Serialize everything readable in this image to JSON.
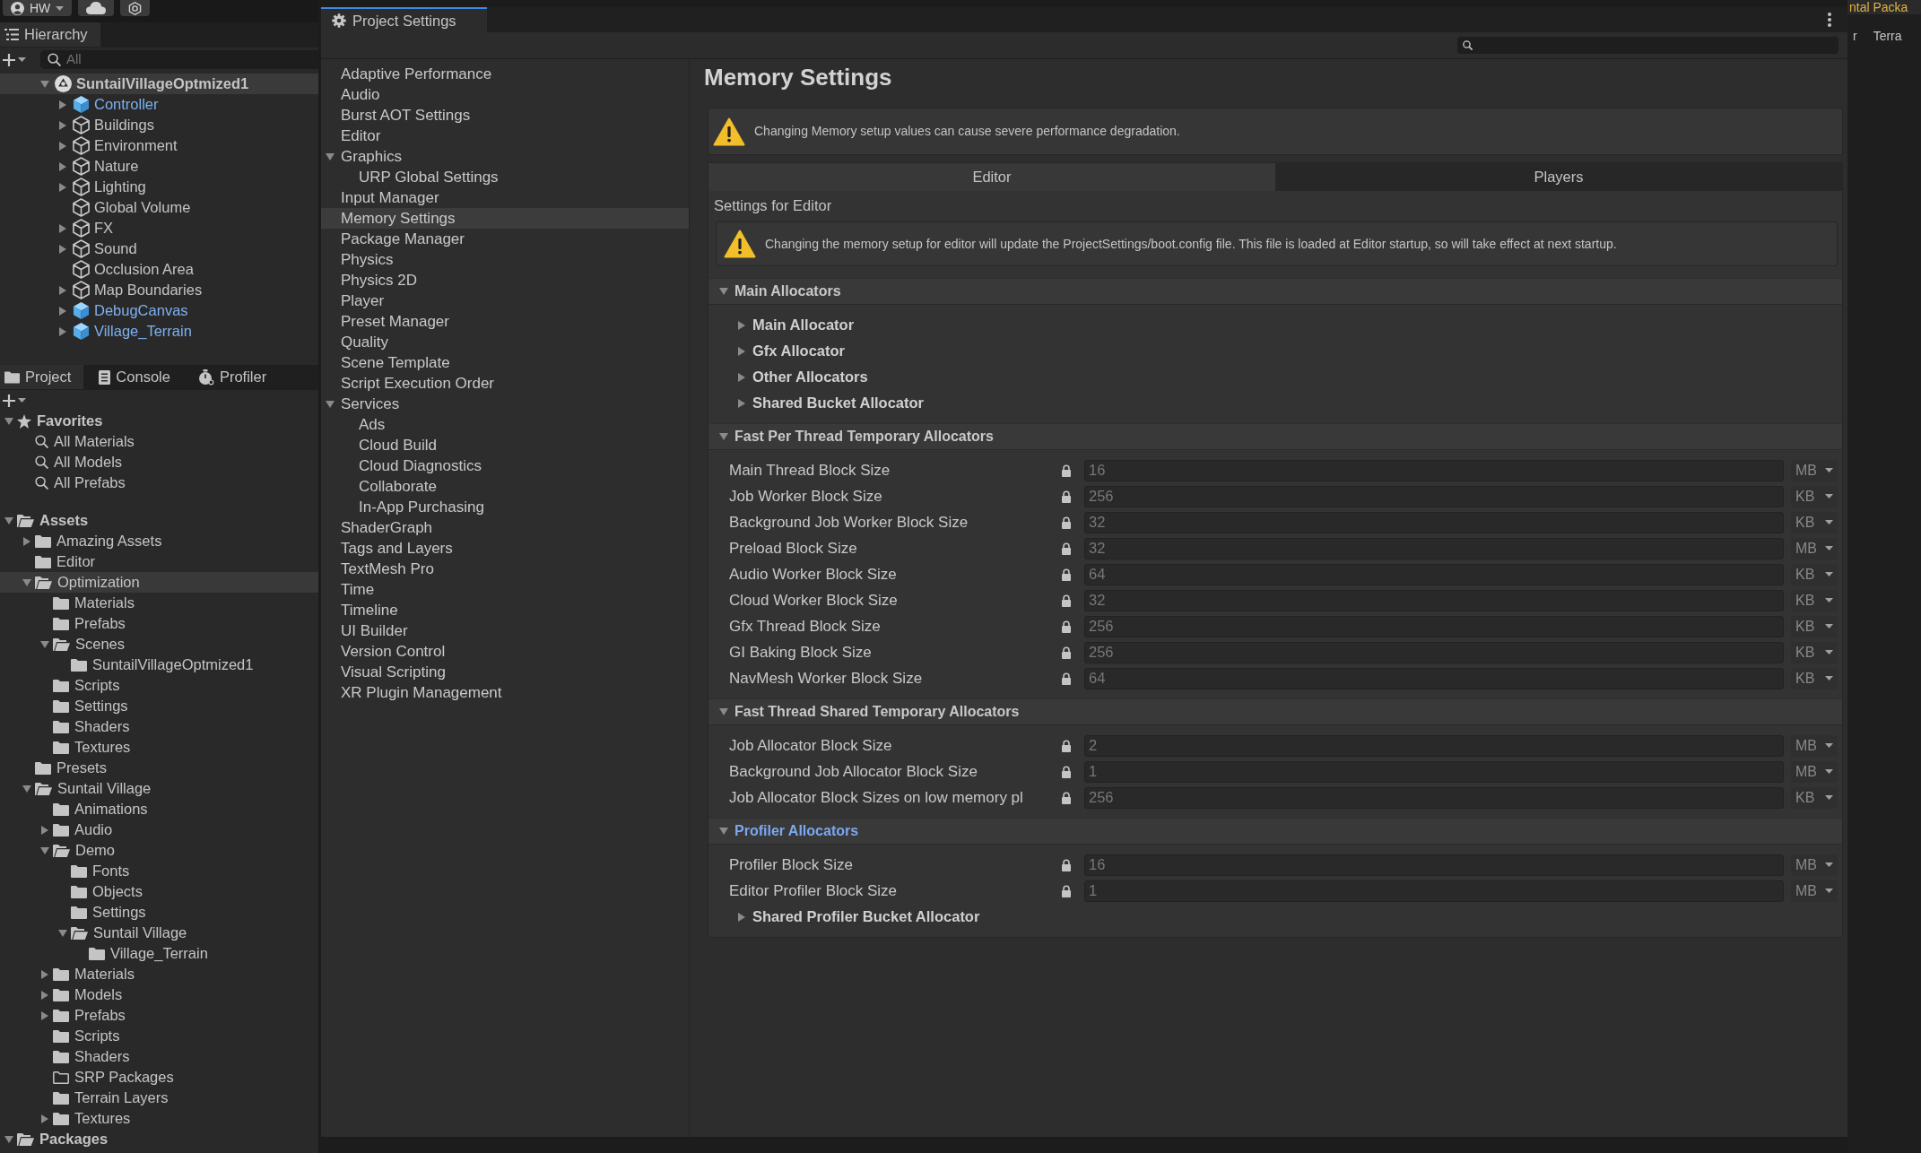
{
  "toolbar": {
    "account": "HW"
  },
  "hierarchy": {
    "tab": {
      "label": "Hierarchy",
      "selected": true
    },
    "search": {
      "placeholder": "All"
    },
    "tree": [
      {
        "label": "SuntailVillageOptmized1",
        "kind": "scene",
        "expanded": true,
        "children": [
          {
            "label": "Controller",
            "kind": "prefab",
            "expanded": false
          },
          {
            "label": "Buildings",
            "kind": "object",
            "expanded": false
          },
          {
            "label": "Environment",
            "kind": "object",
            "expanded": false
          },
          {
            "label": "Nature",
            "kind": "object",
            "expanded": false
          },
          {
            "label": "Lighting",
            "kind": "object",
            "expanded": false
          },
          {
            "label": "Global Volume",
            "kind": "object"
          },
          {
            "label": "FX",
            "kind": "object",
            "expanded": false
          },
          {
            "label": "Sound",
            "kind": "object",
            "expanded": false
          },
          {
            "label": "Occlusion Area",
            "kind": "object"
          },
          {
            "label": "Map Boundaries",
            "kind": "object",
            "expanded": false
          },
          {
            "label": "DebugCanvas",
            "kind": "prefab",
            "expanded": false
          },
          {
            "label": "Village_Terrain",
            "kind": "prefab",
            "expanded": false
          }
        ]
      }
    ]
  },
  "project": {
    "tabs": [
      {
        "label": "Project",
        "kind": "project",
        "selected": true
      },
      {
        "label": "Console",
        "kind": "console",
        "selected": false
      },
      {
        "label": "Profiler",
        "kind": "profiler",
        "selected": false
      }
    ],
    "tree": [
      {
        "label": "Favorites",
        "kind": "favorites",
        "expanded": true,
        "selected": false,
        "children": [
          {
            "label": "All Materials",
            "kind": "search",
            "selected": false
          },
          {
            "label": "All Models",
            "kind": "search",
            "selected": false
          },
          {
            "label": "All Prefabs",
            "kind": "search",
            "selected": false
          }
        ]
      },
      {
        "label": "Assets",
        "kind": "folder",
        "expanded": true,
        "selected": false,
        "children": [
          {
            "label": "Amazing Assets",
            "kind": "folder",
            "expanded": false,
            "selected": false
          },
          {
            "label": "Editor",
            "kind": "folder",
            "selected": false
          },
          {
            "label": "Optimization",
            "kind": "folder",
            "expanded": true,
            "selected": true,
            "children": [
              {
                "label": "Materials",
                "kind": "folder",
                "selected": false
              },
              {
                "label": "Prefabs",
                "kind": "folder",
                "selected": false
              },
              {
                "label": "Scenes",
                "kind": "folder",
                "expanded": true,
                "selected": false,
                "children": [
                  {
                    "label": "SuntailVillageOptmized1",
                    "kind": "folder",
                    "selected": false
                  }
                ]
              },
              {
                "label": "Scripts",
                "kind": "folder",
                "selected": false
              },
              {
                "label": "Settings",
                "kind": "folder",
                "selected": false
              },
              {
                "label": "Shaders",
                "kind": "folder",
                "selected": false
              },
              {
                "label": "Textures",
                "kind": "folder",
                "selected": false
              }
            ]
          },
          {
            "label": "Presets",
            "kind": "folder",
            "selected": false
          },
          {
            "label": "Suntail Village",
            "kind": "folder",
            "expanded": true,
            "selected": false,
            "children": [
              {
                "label": "Animations",
                "kind": "folder",
                "selected": false
              },
              {
                "label": "Audio",
                "kind": "folder",
                "expanded": false,
                "selected": false
              },
              {
                "label": "Demo",
                "kind": "folder",
                "expanded": true,
                "selected": false,
                "children": [
                  {
                    "label": "Fonts",
                    "kind": "folder",
                    "selected": false
                  },
                  {
                    "label": "Objects",
                    "kind": "folder",
                    "selected": false
                  },
                  {
                    "label": "Settings",
                    "kind": "folder",
                    "selected": false
                  },
                  {
                    "label": "Suntail Village",
                    "kind": "folder",
                    "expanded": true,
                    "selected": false,
                    "children": [
                      {
                        "label": "Village_Terrain",
                        "kind": "folder",
                        "selected": false
                      }
                    ]
                  }
                ]
              },
              {
                "label": "Materials",
                "kind": "folder",
                "expanded": false,
                "selected": false
              },
              {
                "label": "Models",
                "kind": "folder",
                "expanded": false,
                "selected": false
              },
              {
                "label": "Prefabs",
                "kind": "folder",
                "expanded": false,
                "selected": false
              },
              {
                "label": "Scripts",
                "kind": "folder",
                "selected": false
              },
              {
                "label": "Shaders",
                "kind": "folder",
                "selected": false
              },
              {
                "label": "SRP Packages",
                "kind": "empty-folder",
                "selected": false
              },
              {
                "label": "Terrain Layers",
                "kind": "folder",
                "selected": false
              },
              {
                "label": "Textures",
                "kind": "folder",
                "expanded": false,
                "selected": false
              }
            ]
          }
        ]
      },
      {
        "label": "Packages",
        "kind": "folder",
        "expanded": true,
        "selected": false
      }
    ]
  },
  "settings_window": {
    "tab": {
      "label": "Project Settings",
      "selected": true
    },
    "sidebar": [
      {
        "label": "Adaptive Performance",
        "selected": false
      },
      {
        "label": "Audio",
        "selected": false
      },
      {
        "label": "Burst AOT Settings",
        "selected": false
      },
      {
        "label": "Editor",
        "selected": false
      },
      {
        "label": "Graphics",
        "selected": false,
        "expanded": true,
        "children": [
          {
            "label": "URP Global Settings",
            "selected": false
          }
        ]
      },
      {
        "label": "Input Manager",
        "selected": false
      },
      {
        "label": "Memory Settings",
        "selected": true
      },
      {
        "label": "Package Manager",
        "selected": false
      },
      {
        "label": "Physics",
        "selected": false
      },
      {
        "label": "Physics 2D",
        "selected": false
      },
      {
        "label": "Player",
        "selected": false
      },
      {
        "label": "Preset Manager",
        "selected": false
      },
      {
        "label": "Quality",
        "selected": false
      },
      {
        "label": "Scene Template",
        "selected": false
      },
      {
        "label": "Script Execution Order",
        "selected": false
      },
      {
        "label": "Services",
        "selected": false,
        "expanded": true,
        "children": [
          {
            "label": "Ads",
            "selected": false
          },
          {
            "label": "Cloud Build",
            "selected": false
          },
          {
            "label": "Cloud Diagnostics",
            "selected": false
          },
          {
            "label": "Collaborate",
            "selected": false
          },
          {
            "label": "In-App Purchasing",
            "selected": false
          }
        ]
      },
      {
        "label": "ShaderGraph",
        "selected": false
      },
      {
        "label": "Tags and Layers",
        "selected": false
      },
      {
        "label": "TextMesh Pro",
        "selected": false
      },
      {
        "label": "Time",
        "selected": false
      },
      {
        "label": "Timeline",
        "selected": false
      },
      {
        "label": "UI Builder",
        "selected": false
      },
      {
        "label": "Version Control",
        "selected": false
      },
      {
        "label": "Visual Scripting",
        "selected": false
      },
      {
        "label": "XR Plugin Management",
        "selected": false
      }
    ],
    "page": {
      "title": "Memory Settings",
      "warning": "Changing Memory setup values can cause severe performance degradation.",
      "tabs": [
        {
          "label": "Editor",
          "selected": true
        },
        {
          "label": "Players",
          "selected": false
        }
      ],
      "subtitle": "Settings for Editor",
      "note": "Changing the memory setup for editor will update the ProjectSettings/boot.config file. This file is loaded at Editor startup, so will take effect at next startup.",
      "sections": [
        {
          "title": "Main Allocators",
          "expanded": true,
          "highlighted": false,
          "items": [
            {
              "kind": "foldout",
              "label": "Main Allocator",
              "expanded": false
            },
            {
              "kind": "foldout",
              "label": "Gfx Allocator",
              "expanded": false
            },
            {
              "kind": "foldout",
              "label": "Other Allocators",
              "expanded": false
            },
            {
              "kind": "foldout",
              "label": "Shared Bucket Allocator",
              "expanded": false
            }
          ]
        },
        {
          "title": "Fast Per Thread Temporary Allocators",
          "expanded": true,
          "highlighted": false,
          "items": [
            {
              "kind": "field",
              "label": "Main Thread Block Size",
              "locked": true,
              "value": "16",
              "unit": "MB"
            },
            {
              "kind": "field",
              "label": "Job Worker Block Size",
              "locked": true,
              "value": "256",
              "unit": "KB"
            },
            {
              "kind": "field",
              "label": "Background Job Worker Block Size",
              "locked": true,
              "value": "32",
              "unit": "KB"
            },
            {
              "kind": "field",
              "label": "Preload Block Size",
              "locked": true,
              "value": "32",
              "unit": "MB"
            },
            {
              "kind": "field",
              "label": "Audio Worker Block Size",
              "locked": true,
              "value": "64",
              "unit": "KB"
            },
            {
              "kind": "field",
              "label": "Cloud Worker Block Size",
              "locked": true,
              "value": "32",
              "unit": "KB"
            },
            {
              "kind": "field",
              "label": "Gfx Thread Block Size",
              "locked": true,
              "value": "256",
              "unit": "KB"
            },
            {
              "kind": "field",
              "label": "GI Baking Block Size",
              "locked": true,
              "value": "256",
              "unit": "KB"
            },
            {
              "kind": "field",
              "label": "NavMesh Worker Block Size",
              "locked": true,
              "value": "64",
              "unit": "KB"
            }
          ]
        },
        {
          "title": "Fast Thread Shared Temporary Allocators",
          "expanded": true,
          "highlighted": false,
          "items": [
            {
              "kind": "field",
              "label": "Job Allocator Block Size",
              "locked": true,
              "value": "2",
              "unit": "MB"
            },
            {
              "kind": "field",
              "label": "Background Job Allocator Block Size",
              "locked": true,
              "value": "1",
              "unit": "MB"
            },
            {
              "kind": "field",
              "label": "Job Allocator Block Sizes on low memory pl",
              "locked": true,
              "value": "256",
              "unit": "KB"
            }
          ]
        },
        {
          "title": "Profiler Allocators",
          "expanded": true,
          "highlighted": true,
          "items": [
            {
              "kind": "field",
              "label": "Profiler Block Size",
              "locked": true,
              "value": "16",
              "unit": "MB"
            },
            {
              "kind": "field",
              "label": "Editor Profiler Block Size",
              "locked": true,
              "value": "1",
              "unit": "MB"
            },
            {
              "kind": "foldout",
              "label": "Shared Profiler Bucket Allocator",
              "expanded": false
            }
          ]
        }
      ]
    }
  },
  "background_panel": {
    "header": "ntal Packa",
    "tabs": [
      "r",
      "Terra"
    ]
  }
}
